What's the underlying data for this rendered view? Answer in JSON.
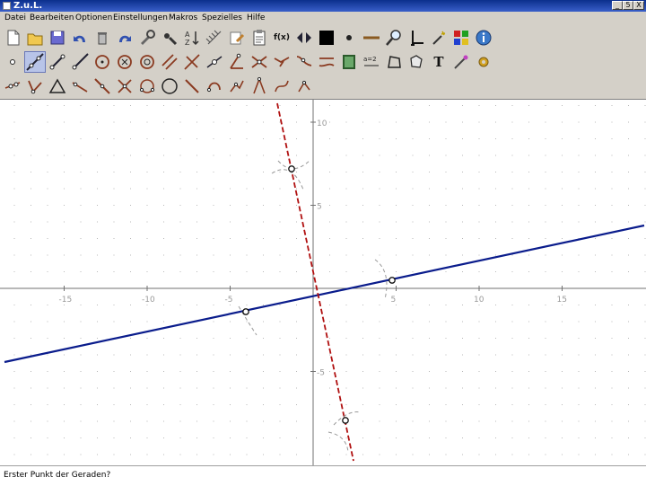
{
  "window": {
    "title": "Z.u.L.",
    "minimize": "_",
    "maximize": "5",
    "close": "X"
  },
  "menu": [
    "Datei",
    "Bearbeiten",
    "Optionen",
    "Einstellungen",
    "Makros",
    "Spezielles",
    "Hilfe"
  ],
  "toolbar": {
    "rows": [
      [
        "new-file-icon",
        "open-file-icon",
        "save-file-icon",
        "undo-icon",
        "delete-icon",
        "redo-icon",
        "properties-icon",
        "hide-icon",
        "sort-icon",
        "grid-icon",
        "edit-icon",
        "clipboard-icon",
        "function-icon",
        "arrows-icon",
        "color-square-icon",
        "point-size-icon",
        "line-width-icon",
        "zoom-icon",
        "axes-icon",
        "magic-wand-icon",
        "palette-icon",
        "info-icon"
      ],
      [
        "point-icon",
        "line-icon",
        "segment-icon",
        "ray-icon",
        "circle-icon",
        "circle-center-icon",
        "circle-fixed-icon",
        "parallel-icon",
        "perpendicular-icon",
        "midpoint-icon",
        "angle-icon",
        "intersection-icon",
        "move-icon",
        "bisector-icon",
        "reflection-icon",
        "animation-icon",
        "expression-icon",
        "polygon-icon",
        "area-icon",
        "text-icon",
        "tracker-icon",
        "settings-icon"
      ],
      [
        "point-on-object-icon",
        "triangle-icon",
        "triangle-outline-icon",
        "tangent-icon",
        "line-through-icon",
        "cross-icon",
        "circle-three-points-icon",
        "circle-outline-icon",
        "diagonal-icon",
        "arc-icon",
        "locus-icon",
        "compass-icon",
        "curve-icon",
        "fixed-angle-icon"
      ]
    ],
    "active_tool": "line-icon",
    "function_label": "f(x)",
    "text_tool_label": "T"
  },
  "canvas": {
    "x_ticks": [
      "-15",
      "-10",
      "-5",
      "5",
      "10",
      "15"
    ],
    "y_ticks": [
      "10",
      "5",
      "-5"
    ],
    "colors": {
      "blue_line": "#0a1c8c",
      "red_line": "#b01010",
      "grid": "#b8b8b8",
      "axis": "#707070"
    }
  },
  "status": "Erster Punkt der Geraden?"
}
